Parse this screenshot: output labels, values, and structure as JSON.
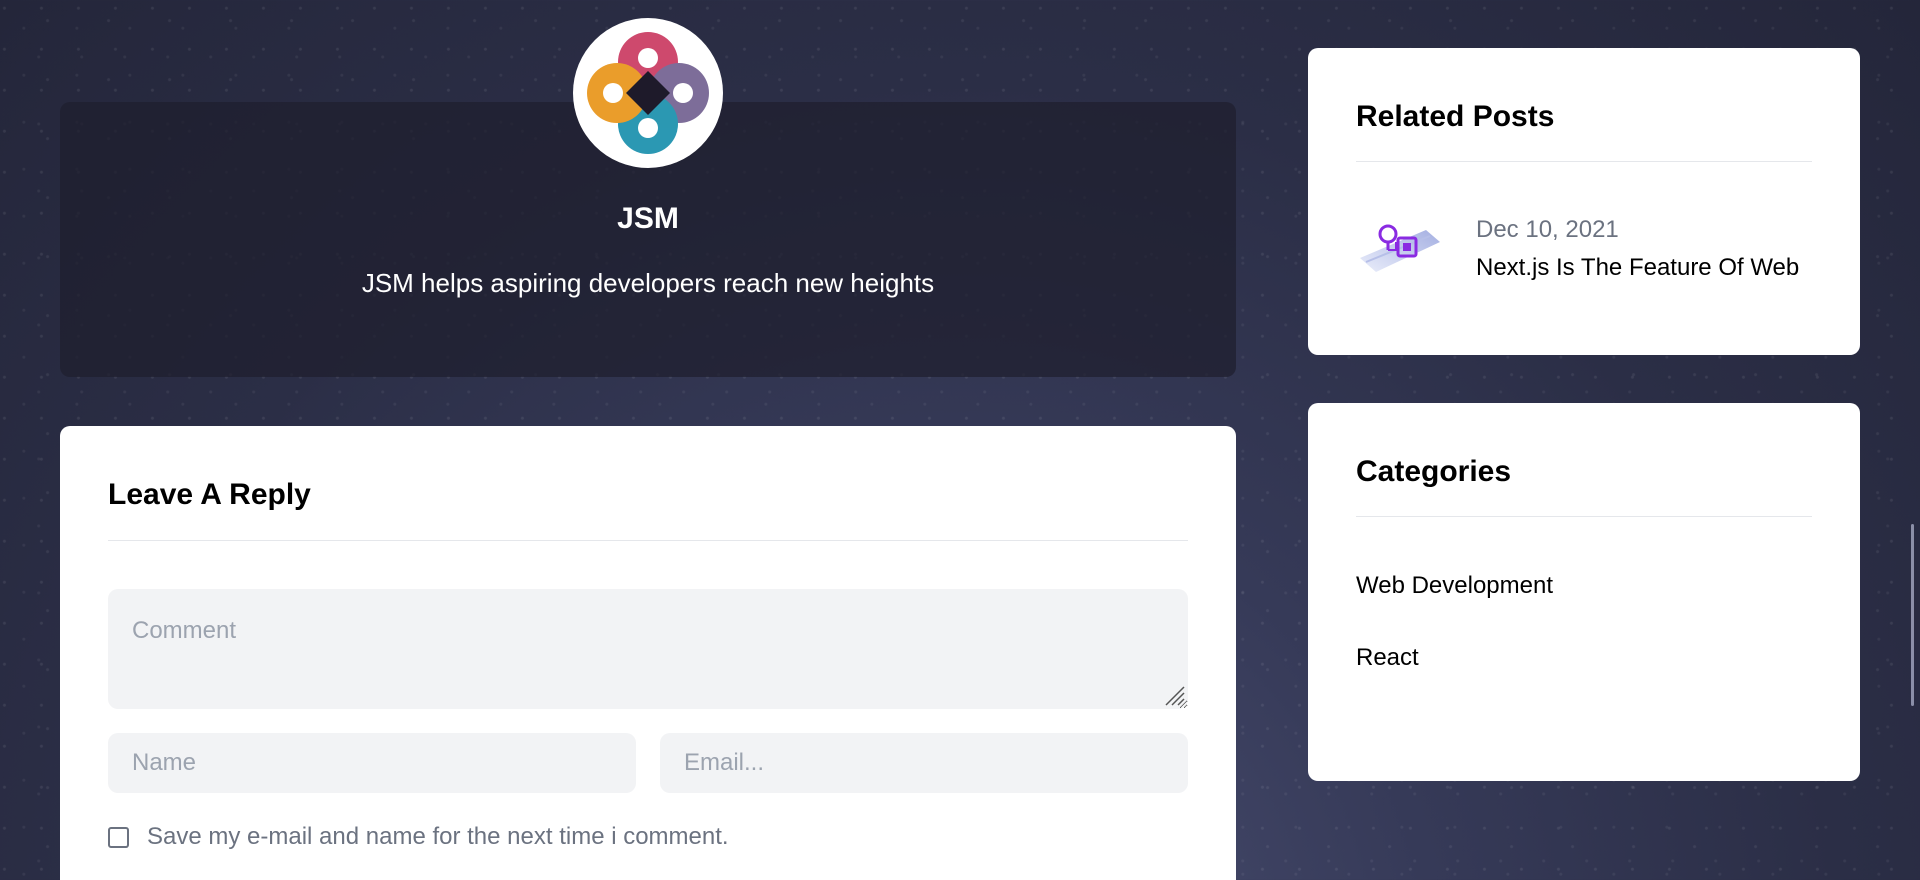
{
  "author": {
    "name": "JSM",
    "description": "JSM helps aspiring developers reach new heights",
    "logo_colors": [
      "#c8305a",
      "#6c5a8c",
      "#0e8aa8",
      "#e8900e"
    ]
  },
  "reply_form": {
    "title": "Leave A Reply",
    "comment_placeholder": "Comment",
    "name_placeholder": "Name",
    "email_placeholder": "Email...",
    "save_label": "Save my e-mail and name for the next time i comment."
  },
  "related_posts": {
    "title": "Related Posts",
    "items": [
      {
        "date": "Dec 10, 2021",
        "title": "Next.js Is The Feature Of Web",
        "thumb_icon": "lightbulb-chip-icon"
      }
    ]
  },
  "categories": {
    "title": "Categories",
    "items": [
      {
        "label": "Web Development"
      },
      {
        "label": "React"
      }
    ]
  }
}
